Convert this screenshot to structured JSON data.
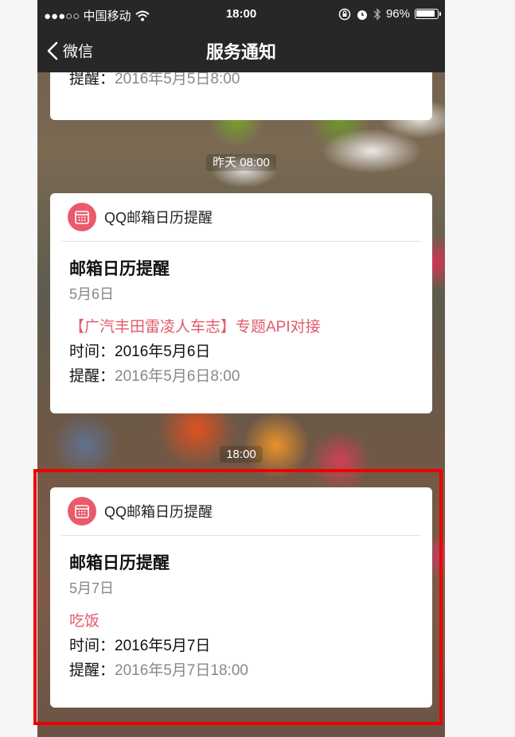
{
  "status_bar": {
    "carrier": "●●●○○ 中国移动",
    "time": "18:00",
    "battery_percent": "96%",
    "battery_level": 0.96
  },
  "nav": {
    "back_label": "微信",
    "title": "服务通知"
  },
  "top_partial": {
    "remind_label": "提醒：",
    "remind_value": "2016年5月5日8:00"
  },
  "messages": [
    {
      "timestamp": "昨天 08:00",
      "app_name": "QQ邮箱日历提醒",
      "title": "邮箱日历提醒",
      "date": "5月6日",
      "subject": "【广汽丰田雷凌人车志】专题API对接",
      "time_label": "时间：",
      "time_value": "2016年5月6日",
      "remind_label": "提醒：",
      "remind_value": "2016年5月6日8:00"
    },
    {
      "timestamp": "18:00",
      "app_name": "QQ邮箱日历提醒",
      "title": "邮箱日历提醒",
      "date": "5月7日",
      "subject": "吃饭",
      "time_label": "时间：",
      "time_value": "2016年5月7日",
      "remind_label": "提醒：",
      "remind_value": "2016年5月7日18:00"
    }
  ],
  "colors": {
    "accent": "#e25a6c",
    "icon_bg": "#ea5a6b",
    "highlight": "#ee0000",
    "bar": "#272727"
  }
}
